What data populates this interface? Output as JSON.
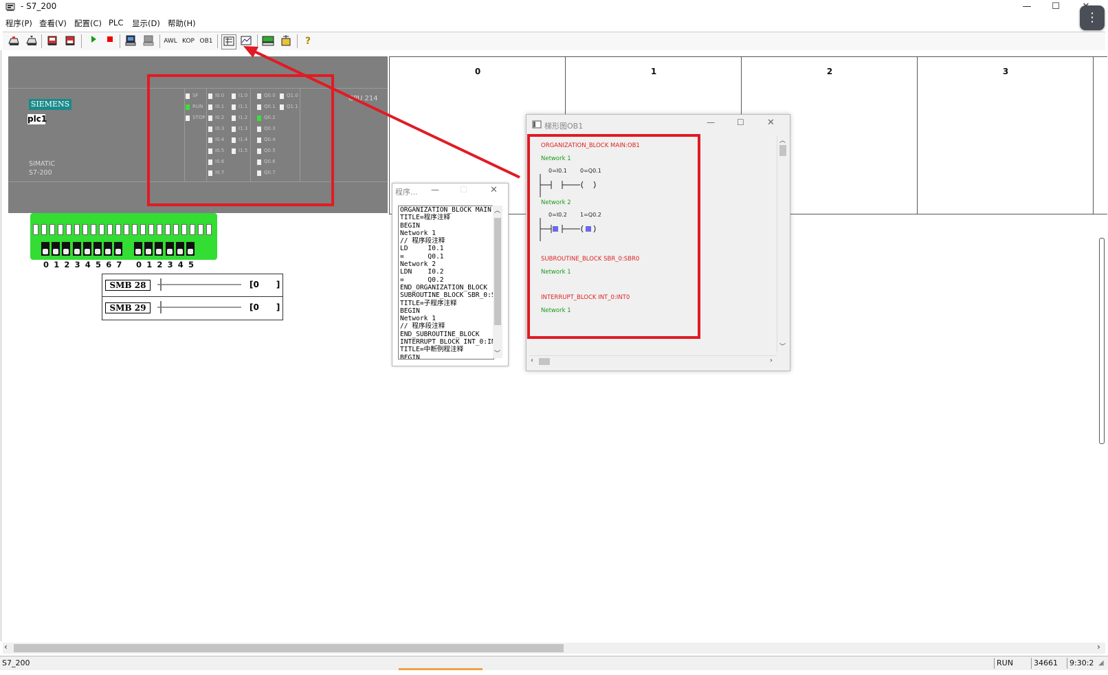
{
  "window": {
    "title": "- S7_200",
    "minimize": "—",
    "maximize": "☐",
    "close": "✕",
    "more": "⋮"
  },
  "menu": [
    "程序(P)",
    "查看(V)",
    "配置(C)",
    "PLC",
    "显示(D)",
    "帮助(H)"
  ],
  "toolbar": {
    "awl": "AWL",
    "kop": "KOP",
    "ob1": "OB1",
    "help": "?"
  },
  "plc": {
    "brand": "SIEMENS",
    "name": "plc1",
    "series_line1": "SIMATIC",
    "series_line2": "S7-200",
    "cpu": "CPU 214",
    "status_leds": [
      {
        "label": "SF",
        "on": false
      },
      {
        "label": "RUN",
        "on": true
      },
      {
        "label": "STOP",
        "on": false
      }
    ],
    "inputs0": [
      {
        "label": "I0.0",
        "on": false
      },
      {
        "label": "I0.1",
        "on": false
      },
      {
        "label": "I0.2",
        "on": false
      },
      {
        "label": "I0.3",
        "on": false
      },
      {
        "label": "I0.4",
        "on": false
      },
      {
        "label": "I0.5",
        "on": false
      },
      {
        "label": "I0.6",
        "on": false
      },
      {
        "label": "I0.7",
        "on": false
      }
    ],
    "inputs1": [
      {
        "label": "I1.0",
        "on": false
      },
      {
        "label": "I1.1",
        "on": false
      },
      {
        "label": "I1.2",
        "on": false
      },
      {
        "label": "I1.3",
        "on": false
      },
      {
        "label": "I1.4",
        "on": false
      },
      {
        "label": "I1.5",
        "on": false
      }
    ],
    "outputs0": [
      {
        "label": "Q0.0",
        "on": false
      },
      {
        "label": "Q0.1",
        "on": false
      },
      {
        "label": "Q0.2",
        "on": true
      },
      {
        "label": "Q0.3",
        "on": false
      },
      {
        "label": "Q0.4",
        "on": false
      },
      {
        "label": "Q0.5",
        "on": false
      },
      {
        "label": "Q0.6",
        "on": false
      },
      {
        "label": "Q0.7",
        "on": false
      }
    ],
    "outputs1": [
      {
        "label": "Q1.0",
        "on": false
      },
      {
        "label": "Q1.1",
        "on": false
      }
    ]
  },
  "slots": [
    "0",
    "1",
    "2",
    "3"
  ],
  "switches": {
    "group0": [
      "0",
      "1",
      "2",
      "3",
      "4",
      "5",
      "6",
      "7"
    ],
    "group1": [
      "0",
      "1",
      "2",
      "3",
      "4",
      "5"
    ]
  },
  "smb": [
    {
      "label": "SMB 28",
      "value": "0"
    },
    {
      "label": "SMB 29",
      "value": "0"
    }
  ],
  "program_window": {
    "title": "程序...",
    "lines": [
      "ORGANIZATION_BLOCK MAIN:",
      "TITLE=程序注释",
      "BEGIN",
      "Network 1",
      "// 程序段注释",
      "LD     I0.1",
      "=      Q0.1",
      "Network 2",
      "LDN    I0.2",
      "=      Q0.2",
      "END_ORGANIZATION_BLOCK",
      "SUBROUTINE_BLOCK SBR_0:S",
      "TITLE=子程序注释",
      "BEGIN",
      "Network 1",
      "// 程序段注释",
      "END_SUBROUTINE_BLOCK",
      "INTERRUPT_BLOCK INT_0:IN",
      "TITLE=中断例程注释",
      "BEGIN"
    ]
  },
  "ladder_window": {
    "title": "梯形图OB1",
    "org_block": "ORGANIZATION_BLOCK MAIN:OB1",
    "network1": "Network 1",
    "n1_contact": "0=I0.1",
    "n1_coil": "0=Q0.1",
    "network2": "Network 2",
    "n2_contact": "0=I0.2",
    "n2_coil": "1=Q0.2",
    "sub_block": "SUBROUTINE_BLOCK SBR_0:SBR0",
    "sub_network": "Network 1",
    "int_block": "INTERRUPT_BLOCK INT_0:INT0",
    "int_network": "Network 1"
  },
  "status": {
    "name": "S7_200",
    "mode": "RUN",
    "counter": "34661",
    "time": "9:30:2"
  },
  "colors": {
    "annotation_red": "#e01b24",
    "led_on": "#3ae03a",
    "switch_board": "#33dd33",
    "siemens_teal": "#1a8a8a"
  }
}
